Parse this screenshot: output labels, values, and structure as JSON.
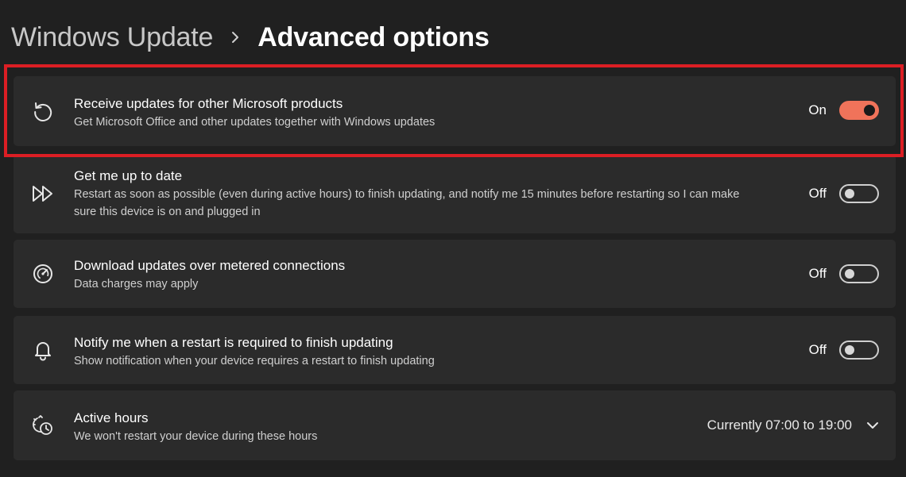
{
  "breadcrumb": {
    "parent": "Windows Update",
    "separator_icon": "chevron-right-icon",
    "current": "Advanced options"
  },
  "settings": [
    {
      "icon": "sync-history-icon",
      "title": "Receive updates for other Microsoft products",
      "description": "Get Microsoft Office and other updates together with Windows updates",
      "state_label": "On",
      "enabled": true,
      "highlighted": true
    },
    {
      "icon": "fast-forward-icon",
      "title": "Get me up to date",
      "description": "Restart as soon as possible (even during active hours) to finish updating, and notify me 15 minutes before restarting so I can make sure this device is on and plugged in",
      "state_label": "Off",
      "enabled": false
    },
    {
      "icon": "gauge-icon",
      "title": "Download updates over metered connections",
      "description": "Data charges may apply",
      "state_label": "Off",
      "enabled": false
    },
    {
      "icon": "bell-icon",
      "title": "Notify me when a restart is required to finish updating",
      "description": "Show notification when your device requires a restart to finish updating",
      "state_label": "Off",
      "enabled": false
    }
  ],
  "active_hours": {
    "icon": "clock-schedule-icon",
    "title": "Active hours",
    "description": "We won't restart your device during these hours",
    "value": "Currently 07:00 to 19:00",
    "expand_icon": "chevron-down-icon"
  },
  "colors": {
    "background": "#202020",
    "card": "#2b2b2b",
    "accent_toggle": "#f0735a",
    "highlight_border": "#dc1e24"
  }
}
